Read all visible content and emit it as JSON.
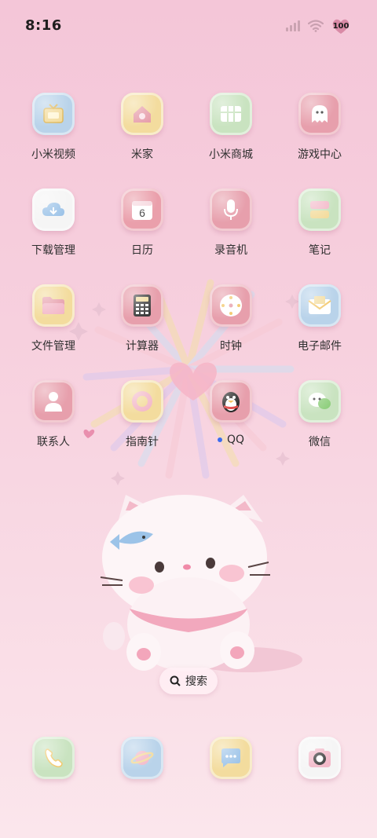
{
  "status": {
    "time": "8:16",
    "battery": "100",
    "icons": [
      "signal-icon",
      "wifi-icon",
      "battery-icon"
    ]
  },
  "apps": [
    {
      "label": "小米视频",
      "icon": "tv-icon",
      "bg": "#b9d3ea"
    },
    {
      "label": "米家",
      "icon": "home-icon",
      "bg": "#f3dc9e"
    },
    {
      "label": "小米商城",
      "icon": "store-icon",
      "bg": "#c9e3c0"
    },
    {
      "label": "游戏中心",
      "icon": "ghost-icon",
      "bg": "#e7a0ad"
    },
    {
      "label": "下载管理",
      "icon": "download-cloud-icon",
      "bg": "#f5f5f5"
    },
    {
      "label": "日历",
      "icon": "calendar-icon",
      "bg": "#ea9fab",
      "day": "6"
    },
    {
      "label": "录音机",
      "icon": "microphone-icon",
      "bg": "#e79fac"
    },
    {
      "label": "笔记",
      "icon": "notes-icon",
      "bg": "#c9e3c0"
    },
    {
      "label": "文件管理",
      "icon": "folder-icon",
      "bg": "#f3dc9e"
    },
    {
      "label": "计算器",
      "icon": "calculator-icon",
      "bg": "#e79fac"
    },
    {
      "label": "时钟",
      "icon": "clock-icon",
      "bg": "#e79fac"
    },
    {
      "label": "电子邮件",
      "icon": "mail-icon",
      "bg": "#b9d3ea"
    },
    {
      "label": "联系人",
      "icon": "contact-icon",
      "bg": "#e79fac"
    },
    {
      "label": "指南针",
      "icon": "compass-icon",
      "bg": "#f3dc9e"
    },
    {
      "label": "QQ",
      "icon": "qq-penguin-icon",
      "bg": "#e79fac",
      "new": true
    },
    {
      "label": "微信",
      "icon": "wechat-icon",
      "bg": "#c9e3c0"
    }
  ],
  "search": {
    "label": "搜索",
    "icon": "search-icon"
  },
  "dock": [
    {
      "name": "phone",
      "icon": "phone-icon",
      "bg": "#c9e3c0"
    },
    {
      "name": "browser",
      "icon": "planet-icon",
      "bg": "#b9d3ea"
    },
    {
      "name": "messages",
      "icon": "message-icon",
      "bg": "#f3dc9e"
    },
    {
      "name": "camera",
      "icon": "camera-icon",
      "bg": "#f5f5f5"
    }
  ]
}
